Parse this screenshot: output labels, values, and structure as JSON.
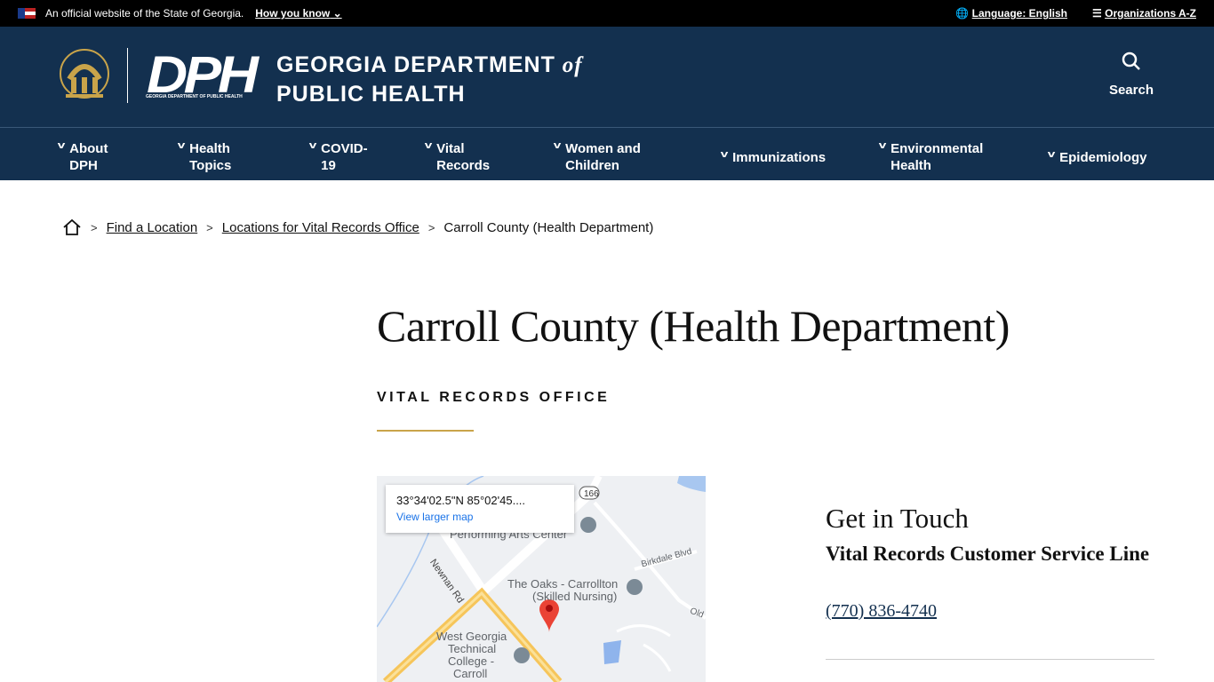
{
  "topbar": {
    "official": "An official website of the State of Georgia.",
    "how": "How you know",
    "language": "Language: English",
    "orgs": "Organizations A-Z"
  },
  "header": {
    "logo_text": "DPH",
    "logo_sub": "GEORGIA DEPARTMENT OF PUBLIC HEALTH",
    "title_line1": "GEORGIA DEPARTMENT",
    "title_of": "of",
    "title_line2": "PUBLIC HEALTH",
    "search_label": "Search"
  },
  "nav": [
    {
      "l1": "About",
      "l2": "DPH"
    },
    {
      "l1": "Health",
      "l2": "Topics"
    },
    {
      "l1": "COVID-",
      "l2": "19"
    },
    {
      "l1": "Vital",
      "l2": "Records"
    },
    {
      "l1": "Women and",
      "l2": "Children"
    },
    {
      "l1": "Immunizations",
      "l2": ""
    },
    {
      "l1": "Environmental",
      "l2": "Health"
    },
    {
      "l1": "Epidemiology",
      "l2": ""
    }
  ],
  "breadcrumb": {
    "items": [
      "Find a Location",
      "Locations for Vital Records Office"
    ],
    "current": "Carroll County (Health Department)"
  },
  "page": {
    "title": "Carroll County (Health Department)",
    "subtitle": "VITAL RECORDS OFFICE"
  },
  "map": {
    "coords": "33°34'02.5\"N 85°02'45....",
    "larger": "View larger map",
    "labels": {
      "route": "166",
      "pac": "Performing Arts Center",
      "newnan": "Newnan Rd",
      "birkdale": "Birkdale Blvd",
      "oaks1": "The Oaks - Carrollton",
      "oaks2": "(Skilled Nursing)",
      "old": "Old",
      "wg1": "West Georgia",
      "wg2": "Technical",
      "wg3": "College -",
      "wg4": "Carroll"
    }
  },
  "contact": {
    "heading": "Get in Touch",
    "line": "Vital Records Customer Service Line",
    "phone": "(770) 836-4740"
  },
  "colors": {
    "navy": "#13304f",
    "gold": "#c9a44a",
    "pin": "#ea4335"
  }
}
